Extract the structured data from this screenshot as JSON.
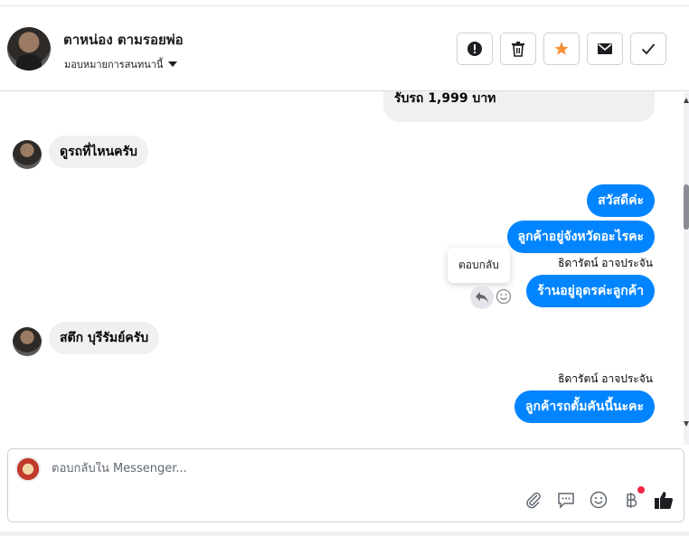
{
  "header": {
    "contact_name": "ตาหน่อง ตามรอยพ่อ",
    "assign_label": "มอบหมายการสนทนานี้"
  },
  "actions": [
    {
      "icon": "alert-icon"
    },
    {
      "icon": "trash-icon"
    },
    {
      "icon": "star-icon",
      "color": "#f7923a"
    },
    {
      "icon": "mail-icon"
    },
    {
      "icon": "check-icon"
    }
  ],
  "messages": [
    {
      "id": "m0",
      "direction": "out",
      "text": "รับรถ 1,999 บาท"
    },
    {
      "id": "m1",
      "direction": "in",
      "text": "ดูรถที่ไหนครับ"
    },
    {
      "id": "m2",
      "direction": "out",
      "text": "สวัสดีค่ะ"
    },
    {
      "id": "m3",
      "direction": "out",
      "text": "ลูกค้าอยู่จังหวัดอะไรคะ"
    },
    {
      "id": "m4",
      "direction": "out",
      "sender": "ธิดารัตน์ อาจประจัน",
      "text": "ร้านอยู่อุดรค่ะลูกค้า"
    },
    {
      "id": "m5",
      "direction": "in",
      "text": "สตึก บุรีรัมย์ครับ"
    },
    {
      "id": "m6",
      "direction": "out",
      "sender": "ธิดารัตน์ อาจประจัน",
      "text": "ลูกค้ารถตั้มคันนี้นะคะ"
    }
  ],
  "tooltip": {
    "text": "ตอบกลับ"
  },
  "composer": {
    "placeholder": "ตอบกลับใน Messenger..."
  },
  "tools": [
    "attach-icon",
    "saved-reply-icon",
    "emoji-icon",
    "baht-payment-icon",
    "like-icon"
  ],
  "colors": {
    "outgoing": "#0084ff",
    "incoming": "#f0f0f0",
    "accent_star": "#f7923a"
  }
}
